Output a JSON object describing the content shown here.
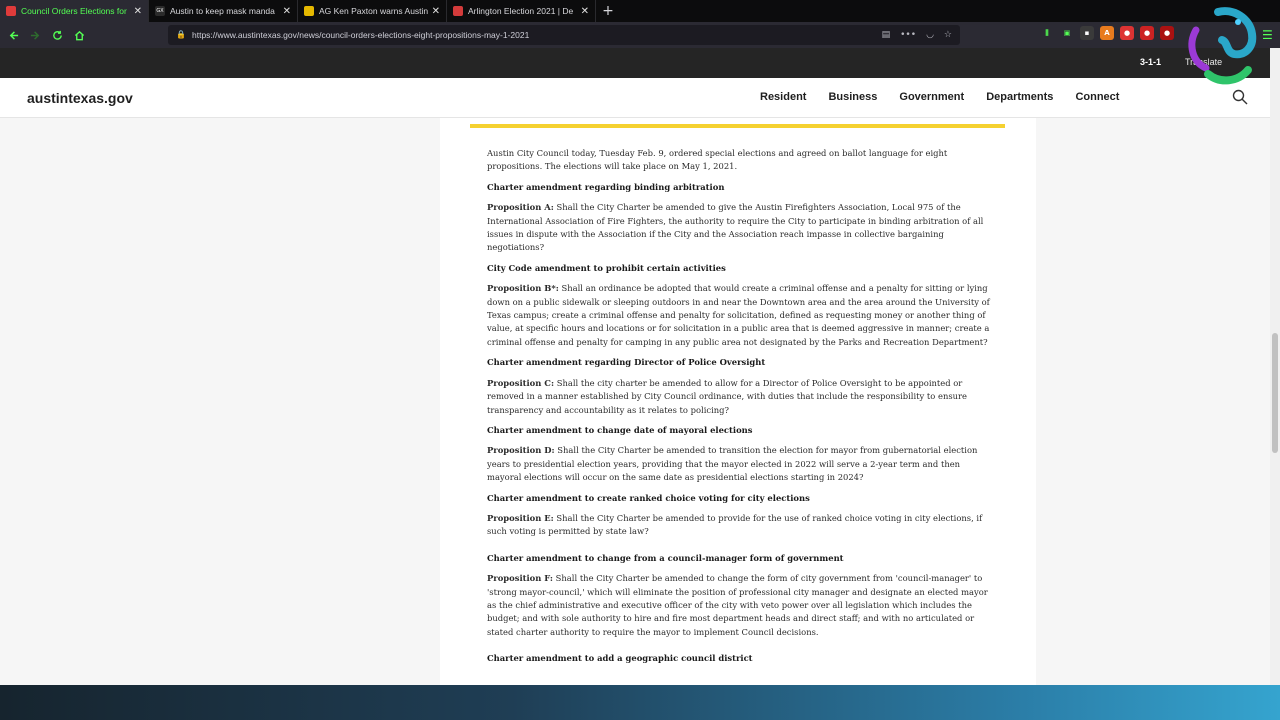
{
  "browser": {
    "tabs": [
      {
        "title": "Council Orders Elections for",
        "favicon_color": "#e03b3b",
        "active": true
      },
      {
        "title": "Austin to keep mask manda",
        "favicon_color": "#2b2b2b",
        "favicon_text": "GX",
        "active": false
      },
      {
        "title": "AG Ken Paxton warns Austin",
        "favicon_color": "#e5b800",
        "active": false
      },
      {
        "title": "Arlington Election 2021 | De",
        "favicon_color": "#d43b3b",
        "active": false
      }
    ],
    "new_tab_label": "+",
    "url": "https://www.austintexas.gov/news/council-orders-elections-eight-propositions-may-1-2021"
  },
  "utility_bar": {
    "three_one_one": "3-1-1",
    "translate": "Translate"
  },
  "site": {
    "logo": "austintexas.gov",
    "nav": [
      "Resident",
      "Business",
      "Government",
      "Departments",
      "Connect"
    ]
  },
  "article": {
    "intro": "Austin City Council today, Tuesday Feb. 9, ordered special elections and agreed on ballot language for eight propositions. The elections will take place on May 1, 2021.",
    "sections": [
      {
        "heading": "Charter amendment regarding binding arbitration",
        "label": "Proposition A:",
        "text": " Shall the City Charter be amended to give the Austin Firefighters Association, Local 975 of the International Association of Fire Fighters, the authority to require the City to participate in binding arbitration of all issues in dispute with the Association if the City and the Association reach impasse in collective bargaining negotiations?"
      },
      {
        "heading": "City Code amendment to prohibit certain activities",
        "label": "Proposition B*:",
        "text": " Shall an ordinance be adopted that would create a criminal offense and a penalty for sitting or lying down on a public sidewalk or sleeping outdoors in and near the Downtown area and the area around the University of Texas campus; create a criminal offense and penalty for solicitation, defined as requesting money or another thing of value, at specific hours and locations or for solicitation in a public area that is deemed aggressive in manner; create a criminal offense and penalty for camping in any public area not designated by the Parks and Recreation Department?"
      },
      {
        "heading": "Charter amendment regarding Director of Police Oversight",
        "label": "Proposition C:",
        "text": " Shall the city charter be amended to allow for a Director of Police Oversight to be appointed or removed in a manner established by City Council ordinance, with duties that include the responsibility to ensure transparency and accountability as it relates to policing?"
      },
      {
        "heading": "Charter amendment to change date of mayoral elections",
        "label": "Proposition D:",
        "text": " Shall the City Charter be amended to transition the election for mayor from gubernatorial election years to presidential election years, providing that the mayor elected in 2022 will serve a 2-year term and then mayoral elections will occur on the same date as presidential elections starting in 2024?"
      },
      {
        "heading": "Charter amendment to create ranked choice voting for city elections",
        "label": "Proposition E:",
        "text": " Shall the City Charter be amended to provide for the use of ranked choice voting in city elections, if such voting is permitted by state law?"
      },
      {
        "heading": "Charter amendment to change from a council-manager form of government",
        "label": "Proposition F:",
        "text": " Shall the City Charter be amended to change the form of city government from 'council-manager' to 'strong mayor-council,' which will eliminate the position of professional city manager and designate an elected mayor as the chief administrative and executive officer of the city with veto power over all legislation which includes the budget; and with sole authority to hire and fire most department heads and direct staff; and with no articulated or stated charter authority to require the mayor to implement Council decisions."
      },
      {
        "heading": "Charter amendment to add a geographic council district",
        "label": "",
        "text": ""
      }
    ]
  },
  "colors": {
    "accent_green": "#54ff54",
    "highlight_yellow": "#f5d130"
  }
}
